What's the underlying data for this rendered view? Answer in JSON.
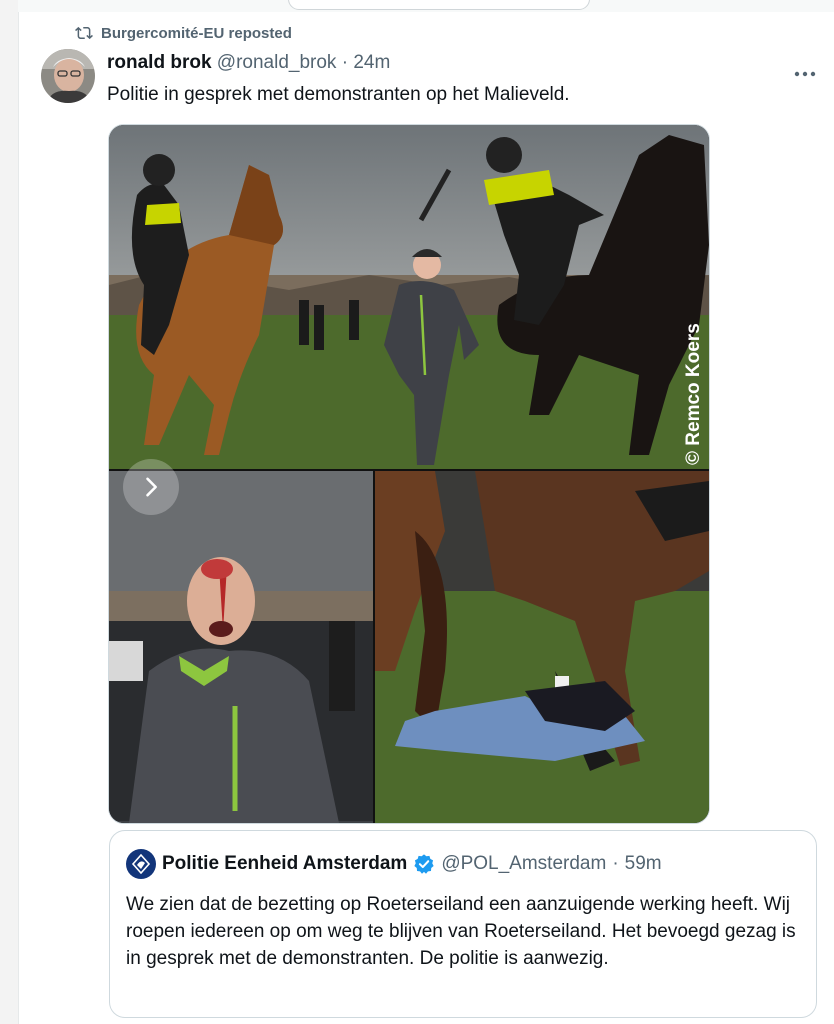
{
  "repost": {
    "label": "Burgercomité-EU reposted",
    "icon": "repost-icon"
  },
  "tweet": {
    "author_name": "ronald brok",
    "author_handle": "@ronald_brok",
    "separator": "·",
    "time": "24m",
    "text": "Politie in gesprek met demonstranten op het Malieveld.",
    "media": {
      "photo_credit": "© Remco Koers",
      "icons": [
        "chevron-right-icon",
        "more-options-icon"
      ]
    }
  },
  "quote": {
    "author_name": "Politie Eenheid Amsterdam",
    "author_handle": "@POL_Amsterdam",
    "separator": "·",
    "time": "59m",
    "verified": true,
    "text": "We zien dat de bezetting op Roeterseiland een aanzuigende werking heeft. Wij roepen iedereen op om weg te blijven van Roeterseiland. Het bevoegd gezag is in gesprek met de demonstranten. De politie is aanwezig."
  },
  "colors": {
    "text": "#0f1419",
    "secondary": "#536471",
    "verified": "#1d9bf0",
    "police_blue": "#12357a",
    "border": "#cfd9de"
  }
}
